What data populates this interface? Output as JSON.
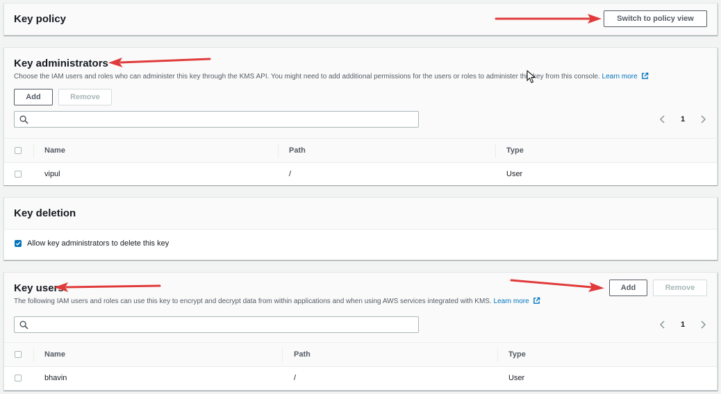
{
  "key_policy": {
    "title": "Key policy",
    "switch_button": "Switch to policy view"
  },
  "key_administrators": {
    "title": "Key administrators",
    "description": "Choose the IAM users and roles who can administer this key through the KMS API. You might need to add additional permissions for the users or roles to administer this key from this console.",
    "learn_more": "Learn more",
    "add_button": "Add",
    "remove_button": "Remove",
    "search_placeholder": "",
    "page_number": "1",
    "columns": [
      "Name",
      "Path",
      "Type"
    ],
    "rows": [
      {
        "name": "vipul",
        "path": "/",
        "type": "User"
      }
    ]
  },
  "key_deletion": {
    "title": "Key deletion",
    "checkbox_label": "Allow key administrators to delete this key",
    "checked": true
  },
  "key_users": {
    "title": "Key users",
    "description": "The following IAM users and roles can use this key to encrypt and decrypt data from within applications and when using AWS services integrated with KMS.",
    "learn_more": "Learn more",
    "add_button": "Add",
    "remove_button": "Remove",
    "search_placeholder": "",
    "page_number": "1",
    "columns": [
      "Name",
      "Path",
      "Type"
    ],
    "rows": [
      {
        "name": "bhavin",
        "path": "/",
        "type": "User"
      }
    ]
  },
  "colors": {
    "annotation_arrow": "#e03a3a",
    "link": "#0073bb",
    "checkbox_checked": "#0073bb"
  },
  "icons": [
    "search-icon",
    "external-link-icon",
    "chevron-left-icon",
    "chevron-right-icon",
    "checkmark-icon",
    "cursor-icon"
  ]
}
